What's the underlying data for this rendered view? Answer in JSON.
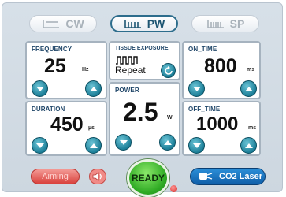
{
  "tabs": [
    {
      "label": "CW",
      "icon": "cw-wave-icon",
      "active": false
    },
    {
      "label": "PW",
      "icon": "pw-pulse-icon",
      "active": true
    },
    {
      "label": "SP",
      "icon": "sp-pulse-icon",
      "active": false
    }
  ],
  "frequency": {
    "title": "FREQUENCY",
    "value": "25",
    "unit": "Hz"
  },
  "duration": {
    "title": "DURATION",
    "value": "450",
    "unit": "µs"
  },
  "tissue_exposure": {
    "title": "TISSUE EXPOSURE",
    "mode": "Repeat"
  },
  "power": {
    "title": "POWER",
    "value": "2.5",
    "unit": "W"
  },
  "on_time": {
    "title": "ON_TIME",
    "value": "800",
    "unit": "ms"
  },
  "off_time": {
    "title": "OFF_TIME",
    "value": "1000",
    "unit": "ms"
  },
  "bottom": {
    "aiming_label": "Aiming",
    "ready_label": "READY",
    "laser_label": "CO2 Laser"
  },
  "colors": {
    "accent": "#1c7f98",
    "ready": "#2faa24",
    "aiming": "#d9423d",
    "laser": "#0f5ea8"
  }
}
